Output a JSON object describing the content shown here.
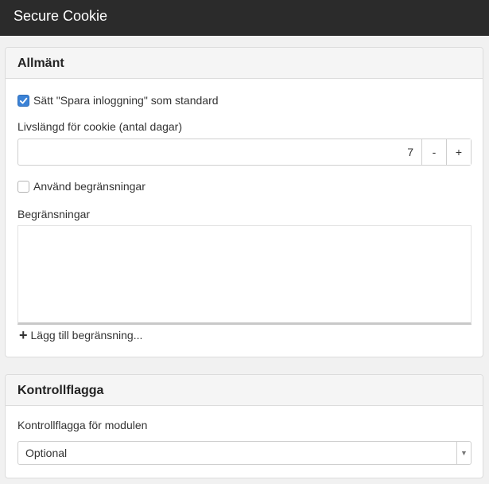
{
  "window": {
    "title": "Secure Cookie"
  },
  "general": {
    "heading": "Allmänt",
    "save_login": {
      "label": "Sätt \"Spara inloggning\" som standard",
      "checked": true
    },
    "lifetime_label": "Livslängd för cookie (antal dagar)",
    "lifetime_value": "7",
    "decrement_label": "-",
    "increment_label": "+",
    "use_restrictions": {
      "label": "Använd begränsningar",
      "checked": false
    },
    "restrictions_label": "Begränsningar",
    "add_restriction_label": "Lägg till begränsning..."
  },
  "control_flag": {
    "heading": "Kontrollflagga",
    "flag_label": "Kontrollflagga för modulen",
    "flag_value": "Optional"
  },
  "colors": {
    "accent": "#3b82d6",
    "titlebar": "#2b2b2b"
  },
  "icons": {
    "checkmark": "checkmark-icon",
    "plus": "plus-icon",
    "dropdown": "chevron-down-icon"
  }
}
